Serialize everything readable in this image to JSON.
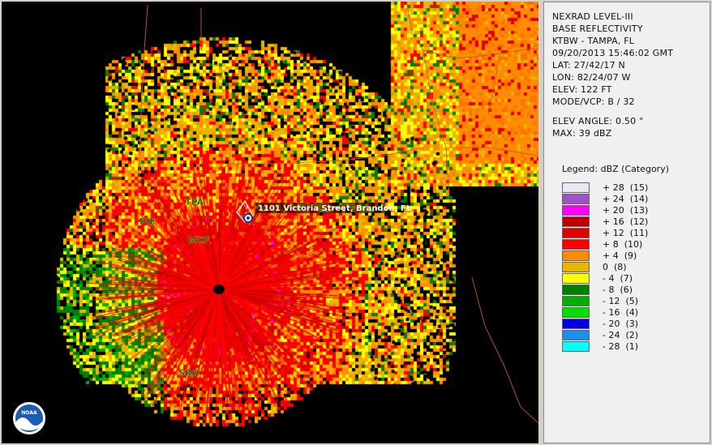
{
  "info": {
    "product": "NEXRAD LEVEL-III",
    "type": "BASE REFLECTIVITY",
    "station": "KTBW - TAMPA, FL",
    "datetime": "09/20/2013 15:46:02 GMT",
    "lat": "LAT: 27/42/17 N",
    "lon": "LON: 82/24/07 W",
    "elev": "ELEV: 122 FT",
    "mode": "MODE/VCP: B / 32",
    "elev_angle": "ELEV ANGLE: 0.50 °",
    "max": "MAX: 39 dBZ"
  },
  "legend": {
    "title": "Legend: dBZ (Category)",
    "items": [
      {
        "label": "+ 28  (15)",
        "color": "#e8e8f0"
      },
      {
        "label": "+ 24  (14)",
        "color": "#a050c8"
      },
      {
        "label": "+ 20  (13)",
        "color": "#ff00ff"
      },
      {
        "label": "+ 16  (12)",
        "color": "#c00000"
      },
      {
        "label": "+ 12  (11)",
        "color": "#e00000"
      },
      {
        "label": "+ 8  (10)",
        "color": "#ff0000"
      },
      {
        "label": "+ 4  (9)",
        "color": "#ff8c00"
      },
      {
        "label": "0  (8)",
        "color": "#e8b800"
      },
      {
        "label": "- 4  (7)",
        "color": "#ffff00"
      },
      {
        "label": "- 8  (6)",
        "color": "#008000"
      },
      {
        "label": "- 12  (5)",
        "color": "#00b000"
      },
      {
        "label": "- 16  (4)",
        "color": "#00e000"
      },
      {
        "label": "- 20  (3)",
        "color": "#0000e0"
      },
      {
        "label": "- 24  (2)",
        "color": "#1890f0"
      },
      {
        "label": "- 28  (1)",
        "color": "#00ffff"
      }
    ]
  },
  "map": {
    "sites": [
      "TPA",
      "PIE",
      "MCF",
      "SRQ"
    ],
    "location_label": "1101 Victoria Street, Brandon, FL",
    "logo_text": "NOAA"
  }
}
